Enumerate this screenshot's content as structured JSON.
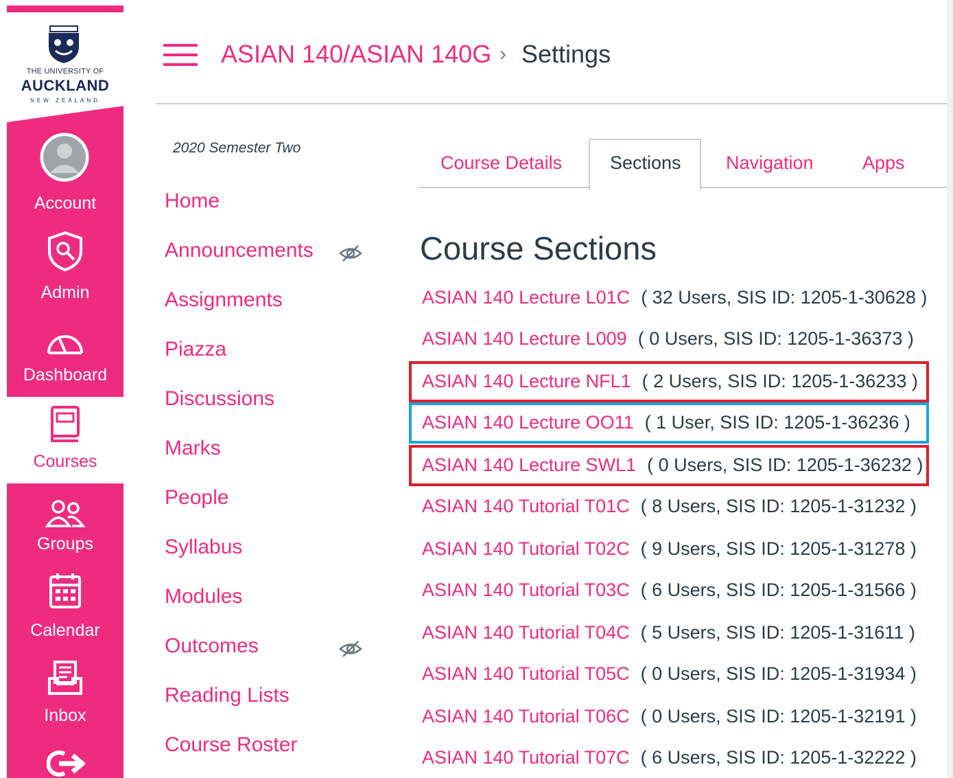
{
  "colors": {
    "brand": "#ef2b80",
    "text": "#2d3b45",
    "highlight_red": "#d9202d",
    "highlight_blue": "#1aa3dc"
  },
  "logo": {
    "line1": "THE UNIVERSITY OF",
    "line2": "AUCKLAND",
    "line3": "NEW ZEALAND"
  },
  "global_nav": [
    {
      "label": "Account",
      "icon": "account-icon"
    },
    {
      "label": "Admin",
      "icon": "shield-icon"
    },
    {
      "label": "Dashboard",
      "icon": "dashboard-gauge-icon"
    },
    {
      "label": "Courses",
      "icon": "book-icon",
      "active": true
    },
    {
      "label": "Groups",
      "icon": "groups-icon"
    },
    {
      "label": "Calendar",
      "icon": "calendar-icon"
    },
    {
      "label": "Inbox",
      "icon": "inbox-icon"
    },
    {
      "label": "",
      "icon": "logout-arrow-icon"
    }
  ],
  "breadcrumb": {
    "course": "ASIAN 140/ASIAN 140G",
    "separator": "›",
    "current": "Settings"
  },
  "term": "2020 Semester Two",
  "course_nav": [
    {
      "label": "Home"
    },
    {
      "label": "Announcements",
      "hidden": true
    },
    {
      "label": "Assignments"
    },
    {
      "label": "Piazza"
    },
    {
      "label": "Discussions"
    },
    {
      "label": "Marks"
    },
    {
      "label": "People"
    },
    {
      "label": "Syllabus"
    },
    {
      "label": "Modules"
    },
    {
      "label": "Outcomes",
      "hidden": true
    },
    {
      "label": "Reading Lists"
    },
    {
      "label": "Course Roster"
    }
  ],
  "tabs": [
    {
      "label": "Course Details"
    },
    {
      "label": "Sections",
      "active": true
    },
    {
      "label": "Navigation"
    },
    {
      "label": "Apps"
    }
  ],
  "sections_title": "Course Sections",
  "sections": [
    {
      "name": "ASIAN 140 Lecture L01C",
      "meta": "( 32 Users, SIS ID: 1205-1-30628 )",
      "highlight": ""
    },
    {
      "name": "ASIAN 140 Lecture L009",
      "meta": "( 0 Users, SIS ID: 1205-1-36373 )",
      "highlight": ""
    },
    {
      "name": "ASIAN 140 Lecture NFL1",
      "meta": "( 2 Users, SIS ID: 1205-1-36233 )",
      "highlight": "red"
    },
    {
      "name": "ASIAN 140 Lecture OO11",
      "meta": "( 1 User, SIS ID: 1205-1-36236 )",
      "highlight": "blue"
    },
    {
      "name": "ASIAN 140 Lecture SWL1",
      "meta": "( 0 Users, SIS ID: 1205-1-36232 )",
      "highlight": "red"
    },
    {
      "name": "ASIAN 140 Tutorial T01C",
      "meta": "( 8 Users, SIS ID: 1205-1-31232 )",
      "highlight": ""
    },
    {
      "name": "ASIAN 140 Tutorial T02C",
      "meta": "( 9 Users, SIS ID: 1205-1-31278 )",
      "highlight": ""
    },
    {
      "name": "ASIAN 140 Tutorial T03C",
      "meta": "( 6 Users, SIS ID: 1205-1-31566 )",
      "highlight": ""
    },
    {
      "name": "ASIAN 140 Tutorial T04C",
      "meta": "( 5 Users, SIS ID: 1205-1-31611 )",
      "highlight": ""
    },
    {
      "name": "ASIAN 140 Tutorial T05C",
      "meta": "( 0 Users, SIS ID: 1205-1-31934 )",
      "highlight": ""
    },
    {
      "name": "ASIAN 140 Tutorial T06C",
      "meta": "( 0 Users, SIS ID: 1205-1-32191 )",
      "highlight": ""
    },
    {
      "name": "ASIAN 140 Tutorial T07C",
      "meta": "( 6 Users, SIS ID: 1205-1-32222 )",
      "highlight": ""
    }
  ]
}
